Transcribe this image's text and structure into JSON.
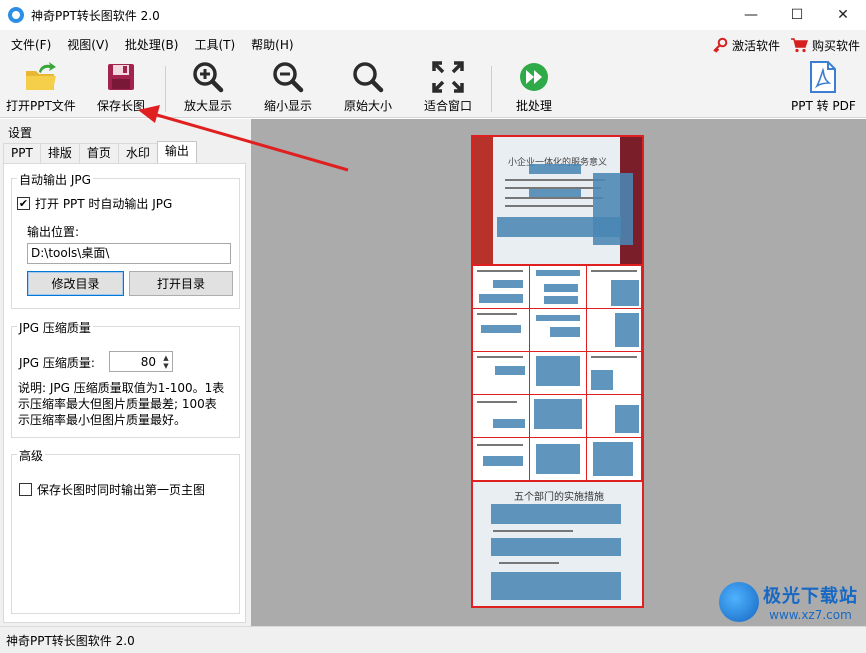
{
  "window": {
    "title": "神奇PPT转长图软件 2.0",
    "controls": {
      "minimize": "—",
      "maximize": "☐",
      "close": "✕"
    }
  },
  "menubar": {
    "items": [
      "文件(F)",
      "视图(V)",
      "批处理(B)",
      "工具(T)",
      "帮助(H)"
    ],
    "activate": "激活软件",
    "buy": "购买软件"
  },
  "toolbar": {
    "open": "打开PPT文件",
    "save": "保存长图",
    "zoom_in": "放大显示",
    "zoom_out": "缩小显示",
    "original": "原始大小",
    "fit": "适合窗口",
    "batch": "批处理",
    "to_pdf": "PPT 转 PDF"
  },
  "settings": {
    "header": "设置",
    "tabs": [
      "PPT",
      "排版",
      "首页",
      "水印",
      "输出"
    ],
    "active_tab": "输出",
    "auto_output": {
      "title": "自动输出 JPG",
      "checkbox_label": "打开 PPT 时自动输出 JPG",
      "checked": true,
      "location_label": "输出位置:",
      "location_value": "D:\\tools\\桌面\\",
      "modify_dir": "修改目录",
      "open_dir": "打开目录"
    },
    "quality": {
      "title": "JPG 压缩质量",
      "label": "JPG 压缩质量:",
      "value": "80",
      "desc_line1": "说明: JPG 压缩质量取值为1-100。1表",
      "desc_line2": "示压缩率最大但图片质量最差; 100表",
      "desc_line3": "示压缩率最小但图片质量最好。"
    },
    "advanced": {
      "title": "高级",
      "checkbox_label": "保存长图时同时输出第一页主图",
      "checked": false
    }
  },
  "preview": {
    "slide1_title": "小企业一体化的服务意义",
    "slide_last_title": "五个部门的实施措施"
  },
  "statusbar": {
    "text": "神奇PPT转长图软件 2.0"
  },
  "watermark": {
    "brand": "极光下载站",
    "url": "www.xz7.com"
  },
  "colors": {
    "accent": "#e02020",
    "slide_blue": "#4a86b4",
    "preview_bg": "#ababab"
  }
}
